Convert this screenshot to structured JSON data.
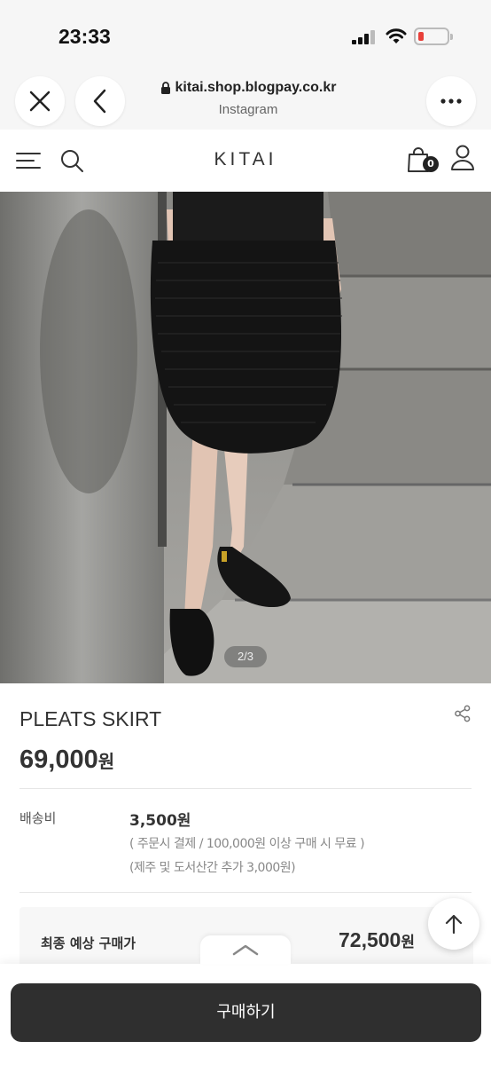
{
  "status_bar": {
    "time": "23:33"
  },
  "browser": {
    "url": "kitai.shop.blogpay.co.kr",
    "subtitle": "Instagram"
  },
  "site": {
    "logo": "KITAI",
    "cart_count": "0"
  },
  "product": {
    "image_pager": "2/3",
    "title": "PLEATS SKIRT",
    "price": "69,000",
    "price_unit": "원"
  },
  "shipping": {
    "label": "배송비",
    "fee": "3,500원",
    "note_1": "( 주문시 결제 / 100,000원 이상 구매 시 무료 )",
    "note_2": "(제주 및 도서산간 추가 3,000원)"
  },
  "final": {
    "label": "최종 예상 구매가",
    "price": "72,500",
    "price_unit": "원"
  },
  "buy_button": {
    "label": "구매하기"
  },
  "colors": {
    "accent": "#2f2f2f",
    "battery_low": "#e8403a"
  }
}
